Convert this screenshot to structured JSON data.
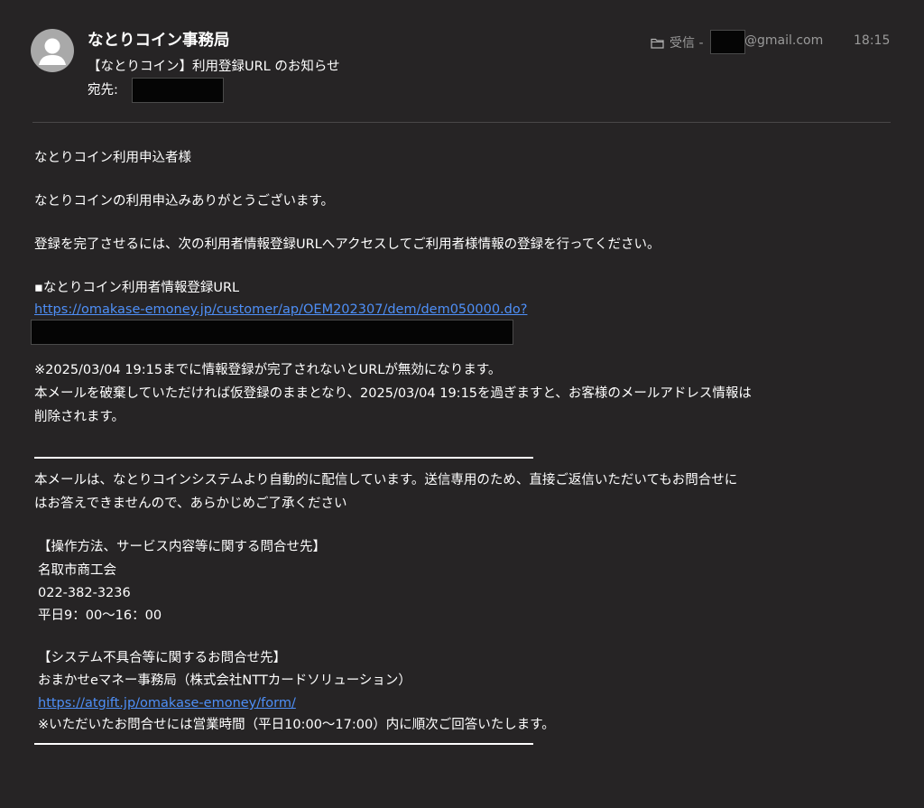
{
  "header": {
    "sender": "なとりコイン事務局",
    "subject": "【なとりコイン】利用登録URL のお知らせ",
    "to_label": "宛先:",
    "folder_label": "受信 -",
    "account_domain": "@gmail.com",
    "time": "18:15"
  },
  "body": {
    "greeting": "なとりコイン利用申込者様",
    "thanks": "なとりコインの利用申込みありがとうございます。",
    "instruction": "登録を完了させるには、次の利用者情報登録URLへアクセスしてご利用者様情報の登録を行ってください。",
    "url_heading": "▪なとりコイン利用者情報登録URL",
    "url_link": "https://omakase-emoney.jp/customer/ap/OEM202307/dem/dem050000.do?",
    "notice_1": "※2025/03/04 19:15までに情報登録が完了されないとURLが無効になります。",
    "notice_2": "本メールを破棄していただければ仮登録のままとなり、2025/03/04 19:15を過ぎますと、お客様のメールアドレス情報は",
    "notice_3": "削除されます。",
    "auto_1": "本メールは、なとりコインシステムより自動的に配信しています。送信専用のため、直接ご返信いただいてもお問合せに",
    "auto_2": "はお答えできませんので、あらかじめご了承ください",
    "contact1_heading": "【操作方法、サービス内容等に関する問合せ先】",
    "contact1_org": "名取市商工会",
    "contact1_phone": "022-382-3236",
    "contact1_hours": "平日9：00〜16：00",
    "contact2_heading": "【システム不具合等に関するお問合せ先】",
    "contact2_org": "おまかせeマネー事務局（株式会社NTTカードソリューション）",
    "contact2_link": "https://atgift.jp/omakase-emoney/form/",
    "contact2_note": "※いただいたお問合せには営業時間（平日10:00〜17:00）内に順次ご回答いたします。"
  },
  "colors": {
    "background": "#262425",
    "link": "#4e8ff7",
    "meta_text": "#9a9a9a",
    "redaction": "#050505"
  }
}
